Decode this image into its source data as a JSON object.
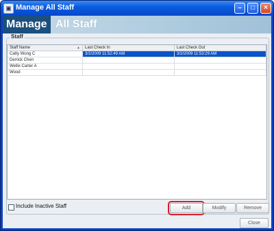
{
  "window": {
    "title": "Manage All Staff"
  },
  "banner": {
    "word1": "Manage",
    "word2": "All Staff"
  },
  "group": {
    "label": "Staff"
  },
  "table": {
    "columns": [
      "Staff Name",
      "Last Check In",
      "Last Check Out"
    ],
    "rows": [
      {
        "name": "Catty Wong C",
        "check_in": "3/2/2009 11:52:49 AM",
        "check_out": "3/2/2009 11:53:29 AM"
      },
      {
        "name": "Derrick Chen",
        "check_in": "",
        "check_out": ""
      },
      {
        "name": "Wellix Carter A",
        "check_in": "",
        "check_out": ""
      },
      {
        "name": "Wood",
        "check_in": "",
        "check_out": ""
      }
    ]
  },
  "checkbox": {
    "label": "Include Inactive Staff",
    "checked": false
  },
  "buttons": {
    "add": "Add",
    "modify": "Modify",
    "remove": "Remove",
    "close": "Close"
  },
  "colors": {
    "selection": "#0a53c8",
    "highlight": "#d61d2a",
    "banner_dark": "#1b4f7d"
  }
}
